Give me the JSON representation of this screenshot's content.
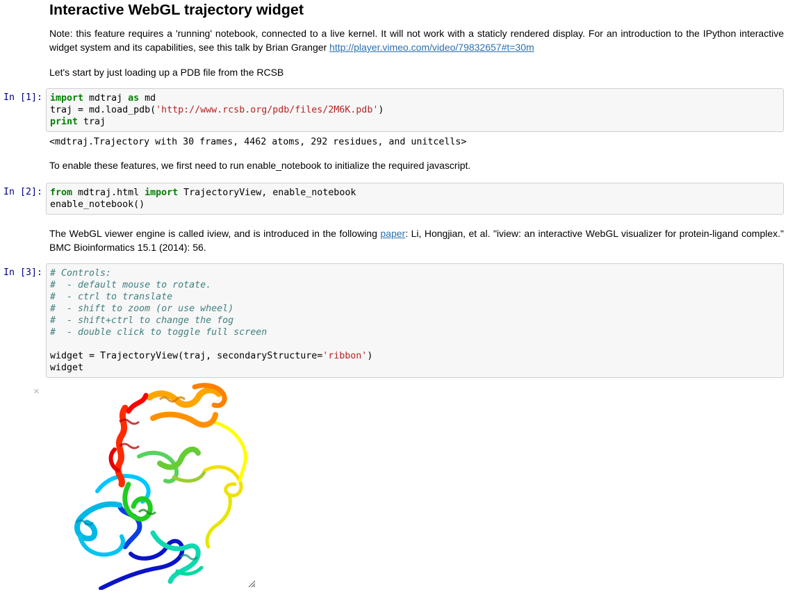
{
  "title": "Interactive WebGL trajectory widget",
  "intro": {
    "text": "Note: this feature requires a 'running' notebook, connected to a live kernel. It will not work with a staticly rendered display. For an introduction to the IPython interactive widget system and its capabilities, see this talk by Brian Granger ",
    "link": "http://player.vimeo.com/video/79832657#t=30m"
  },
  "load_text": "Let's start by just loading up a PDB file from the RCSB",
  "cells": [
    {
      "prompt": "In [1]:",
      "lines": [
        [
          {
            "k": "kw",
            "t": "import"
          },
          {
            "k": "",
            "t": " mdtraj "
          },
          {
            "k": "kw",
            "t": "as"
          },
          {
            "k": "",
            "t": " md"
          }
        ],
        [
          {
            "k": "",
            "t": "traj = md.load_pdb("
          },
          {
            "k": "st",
            "t": "'http://www.rcsb.org/pdb/files/2M6K.pdb'"
          },
          {
            "k": "",
            "t": ")"
          }
        ],
        [
          {
            "k": "kw",
            "t": "print"
          },
          {
            "k": "",
            "t": " traj"
          }
        ]
      ]
    },
    {
      "prompt": "In [2]:",
      "lines": [
        [
          {
            "k": "kw",
            "t": "from"
          },
          {
            "k": "",
            "t": " mdtraj.html "
          },
          {
            "k": "kw",
            "t": "import"
          },
          {
            "k": "",
            "t": " TrajectoryView, enable_notebook"
          }
        ],
        [
          {
            "k": "",
            "t": "enable_notebook()"
          }
        ]
      ]
    },
    {
      "prompt": "In [3]:",
      "lines": [
        [
          {
            "k": "cm",
            "t": "# Controls:"
          }
        ],
        [
          {
            "k": "cm",
            "t": "#  - default mouse to rotate."
          }
        ],
        [
          {
            "k": "cm",
            "t": "#  - ctrl to translate"
          }
        ],
        [
          {
            "k": "cm",
            "t": "#  - shift to zoom (or use wheel)"
          }
        ],
        [
          {
            "k": "cm",
            "t": "#  - shift+ctrl to change the fog"
          }
        ],
        [
          {
            "k": "cm",
            "t": "#  - double click to toggle full screen"
          }
        ],
        [
          {
            "k": "",
            "t": ""
          }
        ],
        [
          {
            "k": "",
            "t": "widget = TrajectoryView(traj, secondaryStructure="
          },
          {
            "k": "st",
            "t": "'ribbon'"
          },
          {
            "k": "",
            "t": ")"
          }
        ],
        [
          {
            "k": "",
            "t": "widget"
          }
        ]
      ]
    }
  ],
  "output_1": "<mdtraj.Trajectory with 30 frames, 4462 atoms, 292 residues, and unitcells>",
  "enable_text": "To enable these features, we first need to run enable_notebook to initialize the required javascript.",
  "iview_text": {
    "before": "The WebGL viewer engine is called iview, and is introduced in the following ",
    "link": "paper",
    "after": ": Li, Hongjian, et al. \"iview: an interactive WebGL visualizer for protein-ligand complex.\" BMC Bioinformatics 15.1 (2014): 56."
  },
  "widget": {
    "close_glyph": "×",
    "ribbon_colors": [
      "#ff0000",
      "#ff6a00",
      "#ffa500",
      "#ffff00",
      "#9acd32",
      "#00cc00",
      "#00d9a0",
      "#00c8ff",
      "#0050ff",
      "#0000cc"
    ]
  }
}
